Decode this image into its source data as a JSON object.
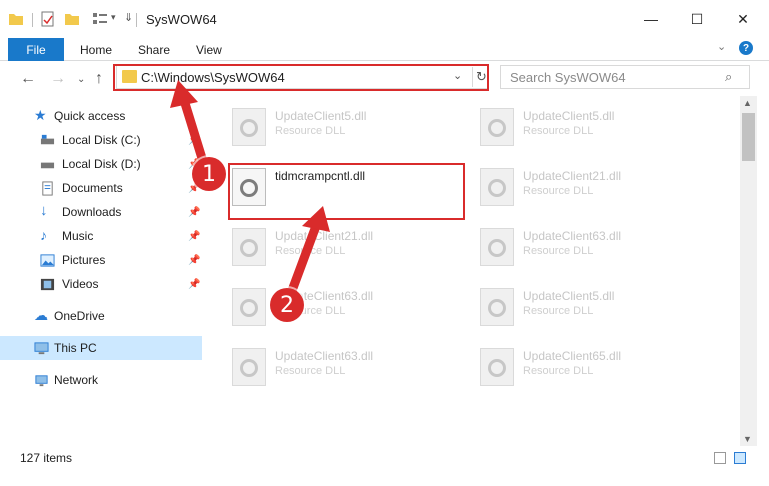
{
  "window": {
    "title": "SysWOW64",
    "minimize": "—",
    "maximize": "☐",
    "close": "✕"
  },
  "ribbon": {
    "tabs": [
      "File",
      "Home",
      "Share",
      "View"
    ],
    "help": "?"
  },
  "address": {
    "path": "C:\\Windows\\SysWOW64",
    "search_placeholder": "Search SysWOW64"
  },
  "sidebar": {
    "items": [
      {
        "label": "Quick access",
        "icon": "star-icon",
        "pinned": false
      },
      {
        "label": "Local Disk (C:)",
        "icon": "drive-icon",
        "pinned": true
      },
      {
        "label": "Local Disk (D:)",
        "icon": "drive-icon",
        "pinned": true
      },
      {
        "label": "Documents",
        "icon": "documents-icon",
        "pinned": true
      },
      {
        "label": "Downloads",
        "icon": "download-icon",
        "pinned": true
      },
      {
        "label": "Music",
        "icon": "music-icon",
        "pinned": true
      },
      {
        "label": "Pictures",
        "icon": "pictures-icon",
        "pinned": true
      },
      {
        "label": "Videos",
        "icon": "videos-icon",
        "pinned": true
      },
      {
        "label": "OneDrive",
        "icon": "cloud-icon",
        "pinned": false
      },
      {
        "label": "This PC",
        "icon": "computer-icon",
        "pinned": false,
        "selected": true
      },
      {
        "label": "Network",
        "icon": "network-icon",
        "pinned": false
      }
    ]
  },
  "files": {
    "type_label": "Resource DLL",
    "items": [
      {
        "name": "UpdateClient5.dll"
      },
      {
        "name": "UpdateClient5.dll"
      },
      {
        "name": "tidmcrampcntl.dll",
        "focused": true
      },
      {
        "name": "UpdateClient21.dll"
      },
      {
        "name": "UpdateClient21.dll"
      },
      {
        "name": "UpdateClient63.dll"
      },
      {
        "name": "UpdateClient63.dll"
      },
      {
        "name": "UpdateClient5.dll"
      },
      {
        "name": "UpdateClient63.dll"
      },
      {
        "name": "UpdateClient65.dll"
      }
    ]
  },
  "status": {
    "item_count": "127 items"
  },
  "annotations": {
    "step1": "1",
    "step2": "2",
    "color": "#d92b2b"
  }
}
